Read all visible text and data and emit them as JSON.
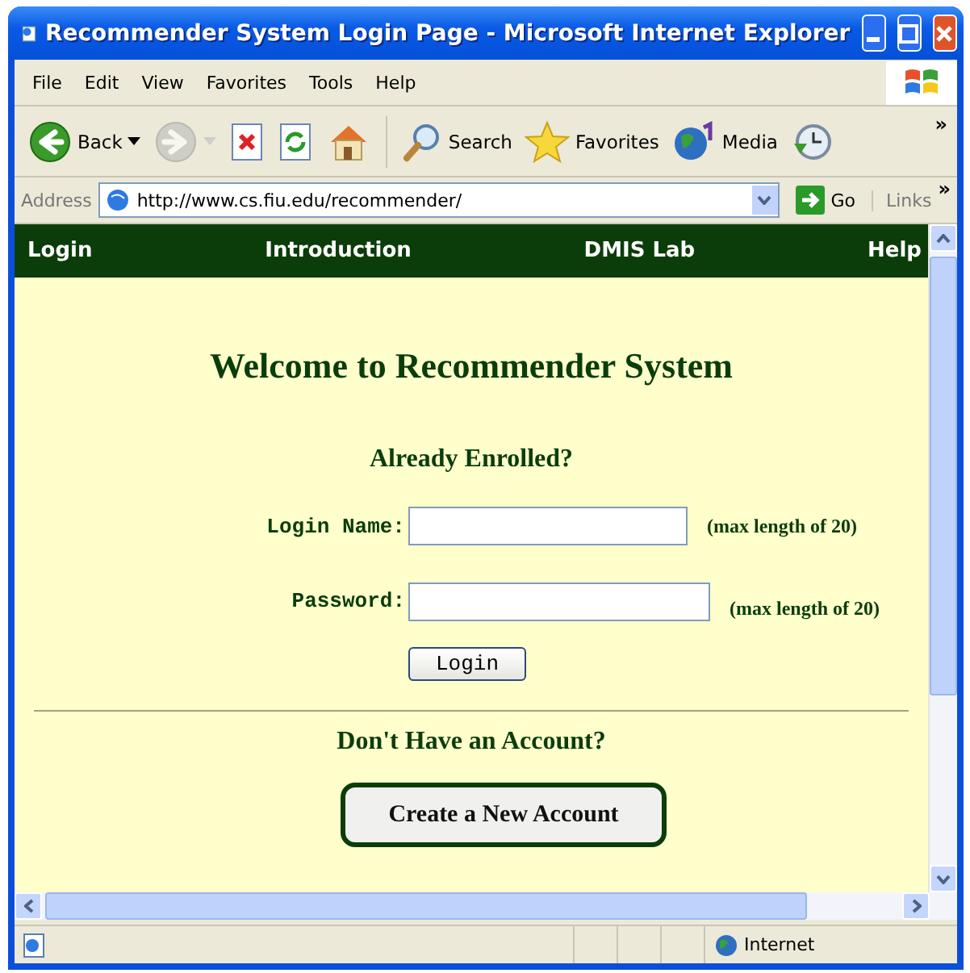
{
  "window": {
    "title": "Recommender System Login Page - Microsoft Internet Explorer"
  },
  "menu": [
    "File",
    "Edit",
    "View",
    "Favorites",
    "Tools",
    "Help"
  ],
  "toolbar": [
    {
      "kind": "back",
      "label": "Back",
      "disabled": false
    },
    {
      "kind": "forward",
      "disabled": true
    },
    {
      "kind": "stop",
      "disabled": false
    },
    {
      "kind": "refresh",
      "disabled": false
    },
    {
      "kind": "home",
      "disabled": false
    },
    {
      "kind": "search",
      "label": "Search",
      "disabled": false
    },
    {
      "kind": "favorites",
      "label": "Favorites",
      "disabled": false
    },
    {
      "kind": "media",
      "label": "Media",
      "disabled": false
    },
    {
      "kind": "history",
      "disabled": false
    }
  ],
  "toolbar_more": "»",
  "address_bar": {
    "label": "Address",
    "url": "http://www.cs.fiu.edu/recommender/",
    "go": "Go",
    "links": "Links",
    "links_more": "»"
  },
  "nav": [
    "Login",
    "Introduction",
    "DMIS Lab",
    "Help"
  ],
  "page": {
    "heading": "Welcome to Recommender System",
    "login_section": {
      "title": "Already Enrolled?",
      "fields": [
        {
          "label": "Login Name:",
          "hint": "(max length of 20)"
        },
        {
          "label": "Password:",
          "hint": "(max length of 20)"
        }
      ],
      "button": "Login"
    },
    "signup_section": {
      "title": "Don't Have an Account?",
      "button": "Create a New Account"
    }
  },
  "status_bar": {
    "zone": "Internet"
  }
}
